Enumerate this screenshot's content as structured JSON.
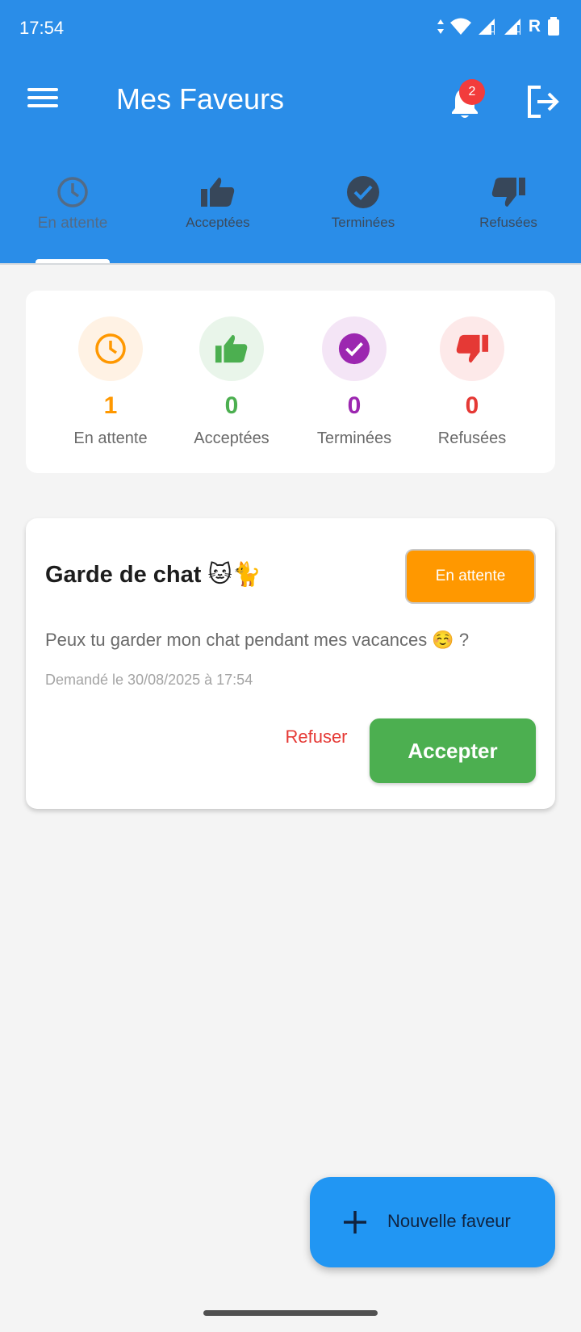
{
  "status_bar": {
    "time": "17:54",
    "network": "R"
  },
  "toolbar": {
    "title": "Mes Faveurs",
    "notification_count": "2"
  },
  "tabs": [
    {
      "label": "En attente",
      "icon": "clock-icon",
      "active": true
    },
    {
      "label": "Acceptées",
      "icon": "thumbs-up-icon",
      "active": false
    },
    {
      "label": "Terminées",
      "icon": "check-circle-icon",
      "active": false
    },
    {
      "label": "Refusées",
      "icon": "thumbs-down-icon",
      "active": false
    }
  ],
  "stats": [
    {
      "value": "1",
      "label": "En attente",
      "icon": "clock-icon",
      "color": "#ff9800",
      "bg": "#fff2e4"
    },
    {
      "value": "0",
      "label": "Acceptées",
      "icon": "thumbs-up-icon",
      "color": "#4caf50",
      "bg": "#e9f5ea"
    },
    {
      "value": "0",
      "label": "Terminées",
      "icon": "check-circle-icon",
      "color": "#9c27b0",
      "bg": "#f4e5f6"
    },
    {
      "value": "0",
      "label": "Refusées",
      "icon": "thumbs-down-icon",
      "color": "#e53935",
      "bg": "#fde9e9"
    }
  ],
  "favor": {
    "title": "Garde de chat 🐱🐈",
    "status": "En attente",
    "description": "Peux tu garder mon chat pendant mes vacances ☺️ ?",
    "date": "Demandé le 30/08/2025 à 17:54",
    "refuse_label": "Refuser",
    "accept_label": "Accepter"
  },
  "fab": {
    "label": "Nouvelle faveur"
  },
  "colors": {
    "primary": "#2a8de8",
    "pending": "#ff9800",
    "accepted": "#4caf50",
    "done": "#9c27b0",
    "refused": "#e53935"
  }
}
